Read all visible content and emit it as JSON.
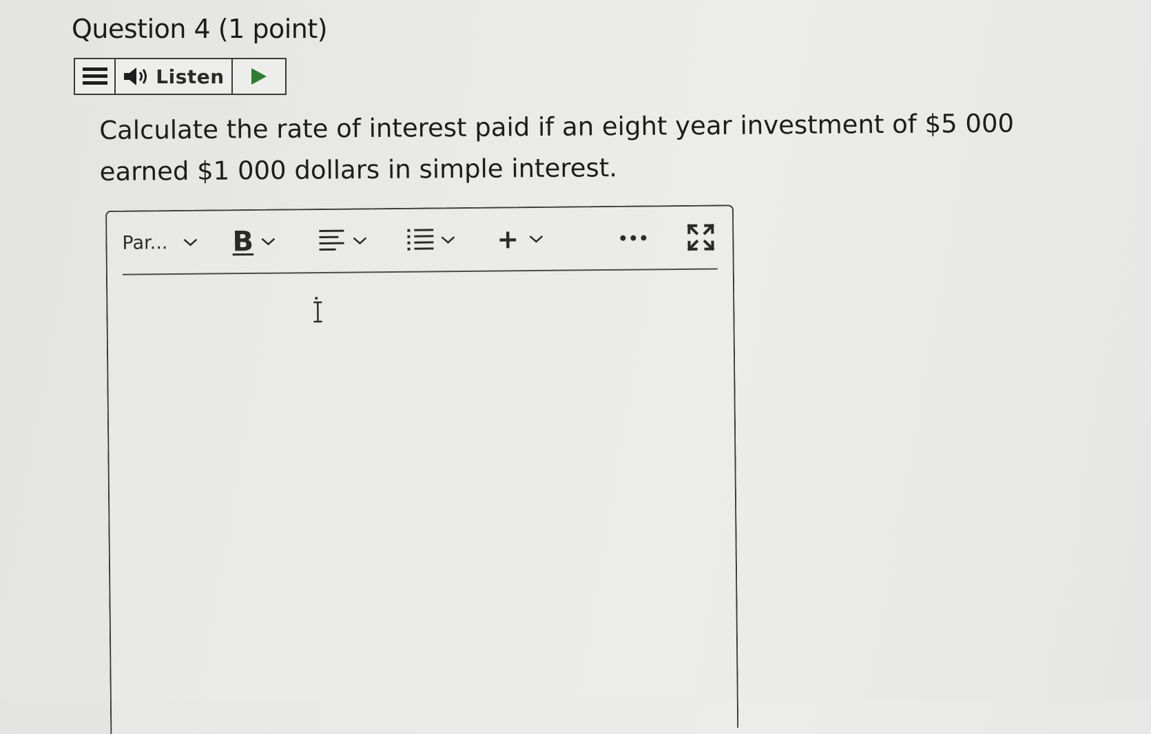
{
  "question": {
    "title": "Question 4 (1 point)",
    "text": "Calculate the rate of interest paid if an eight year investment of $5 000 earned $1 000 dollars in simple interest."
  },
  "listen_bar": {
    "menu_icon": "hamburger-menu-icon",
    "speaker_icon": "speaker-icon",
    "label": "Listen",
    "play_icon": "play-icon",
    "play_color": "#2e7d32"
  },
  "editor": {
    "toolbar": {
      "paragraph_format": "Par...",
      "bold_label": "B",
      "align_icon": "align-left-icon",
      "list_icon": "bulleted-list-icon",
      "insert_label": "+",
      "more_icon": "more-options-icon",
      "fullscreen_icon": "fullscreen-icon"
    },
    "content": ""
  }
}
